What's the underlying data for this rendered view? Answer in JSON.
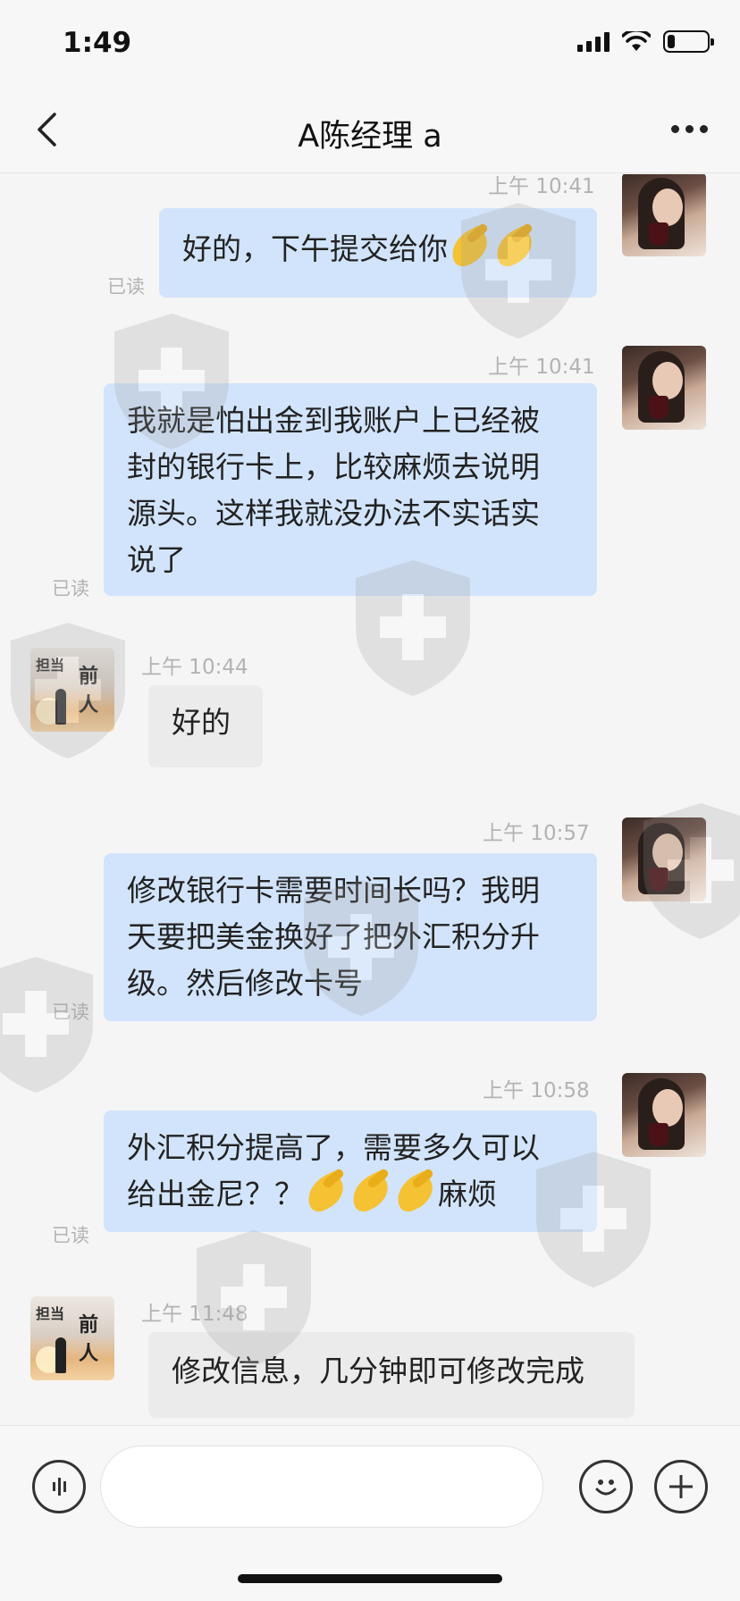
{
  "status_bar": {
    "time": "1:49",
    "battery_level_percent": 20
  },
  "nav": {
    "title": "A陈经理 a"
  },
  "messages": [
    {
      "side": "me",
      "time": "上午 10:41",
      "text": "好的，下午提交给你",
      "emoji_after": 2,
      "trailing": "",
      "read": "已读"
    },
    {
      "side": "me",
      "time": "上午 10:41",
      "lines": [
        "我就是怕出金到我账户上已经被",
        "封的银行卡上，比较麻烦去说明",
        "源头。这样我就没办法不实话实",
        "说了"
      ],
      "read": "已读"
    },
    {
      "side": "other",
      "time": "上午 10:44",
      "text": "好的"
    },
    {
      "side": "me",
      "time": "上午 10:57",
      "lines": [
        "修改银行卡需要时间长吗？我明",
        "天要把美金换好了把外汇积分升",
        "级。然后修改卡号"
      ],
      "read": "已读"
    },
    {
      "side": "me",
      "time": "上午 10:58",
      "line1": "外汇积分提高了，需要多久可以",
      "line2_text": "给出金尼？？",
      "line2_emoji": 3,
      "line2_trailing": "麻烦",
      "read": "已读"
    },
    {
      "side": "other",
      "time": "上午 11:48",
      "text": "修改信息，几分钟即可修改完成"
    }
  ],
  "avatar_other": {
    "label_left": "担当",
    "label_right": "前人"
  },
  "input": {
    "value": ""
  },
  "icons": [
    "back-arrow-icon",
    "more-icon",
    "voice-icon",
    "emoji-icon",
    "plus-icon",
    "signal-icon",
    "wifi-icon",
    "battery-icon"
  ],
  "colors": {
    "bubble_me": "#d2e4fb",
    "bubble_other": "#ebebeb",
    "timestamp": "#b3b3b3"
  }
}
